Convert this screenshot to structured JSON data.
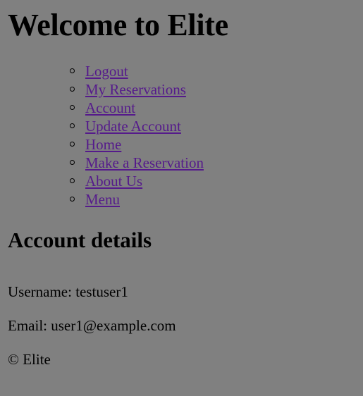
{
  "page": {
    "title": "Welcome to Elite"
  },
  "nav": {
    "items": [
      {
        "label": "Logout"
      },
      {
        "label": "My Reservations"
      },
      {
        "label": "Account"
      },
      {
        "label": "Update Account"
      },
      {
        "label": "Home"
      },
      {
        "label": "Make a Reservation"
      },
      {
        "label": "About Us"
      },
      {
        "label": "Menu"
      }
    ]
  },
  "account": {
    "heading": "Account details",
    "username_line": "Username: testuser1",
    "email_line": "Email: user1@example.com"
  },
  "footer": {
    "text": "© Elite"
  },
  "colors": {
    "background": "#808080",
    "link_visited": "#551a8b",
    "text": "#000000"
  }
}
